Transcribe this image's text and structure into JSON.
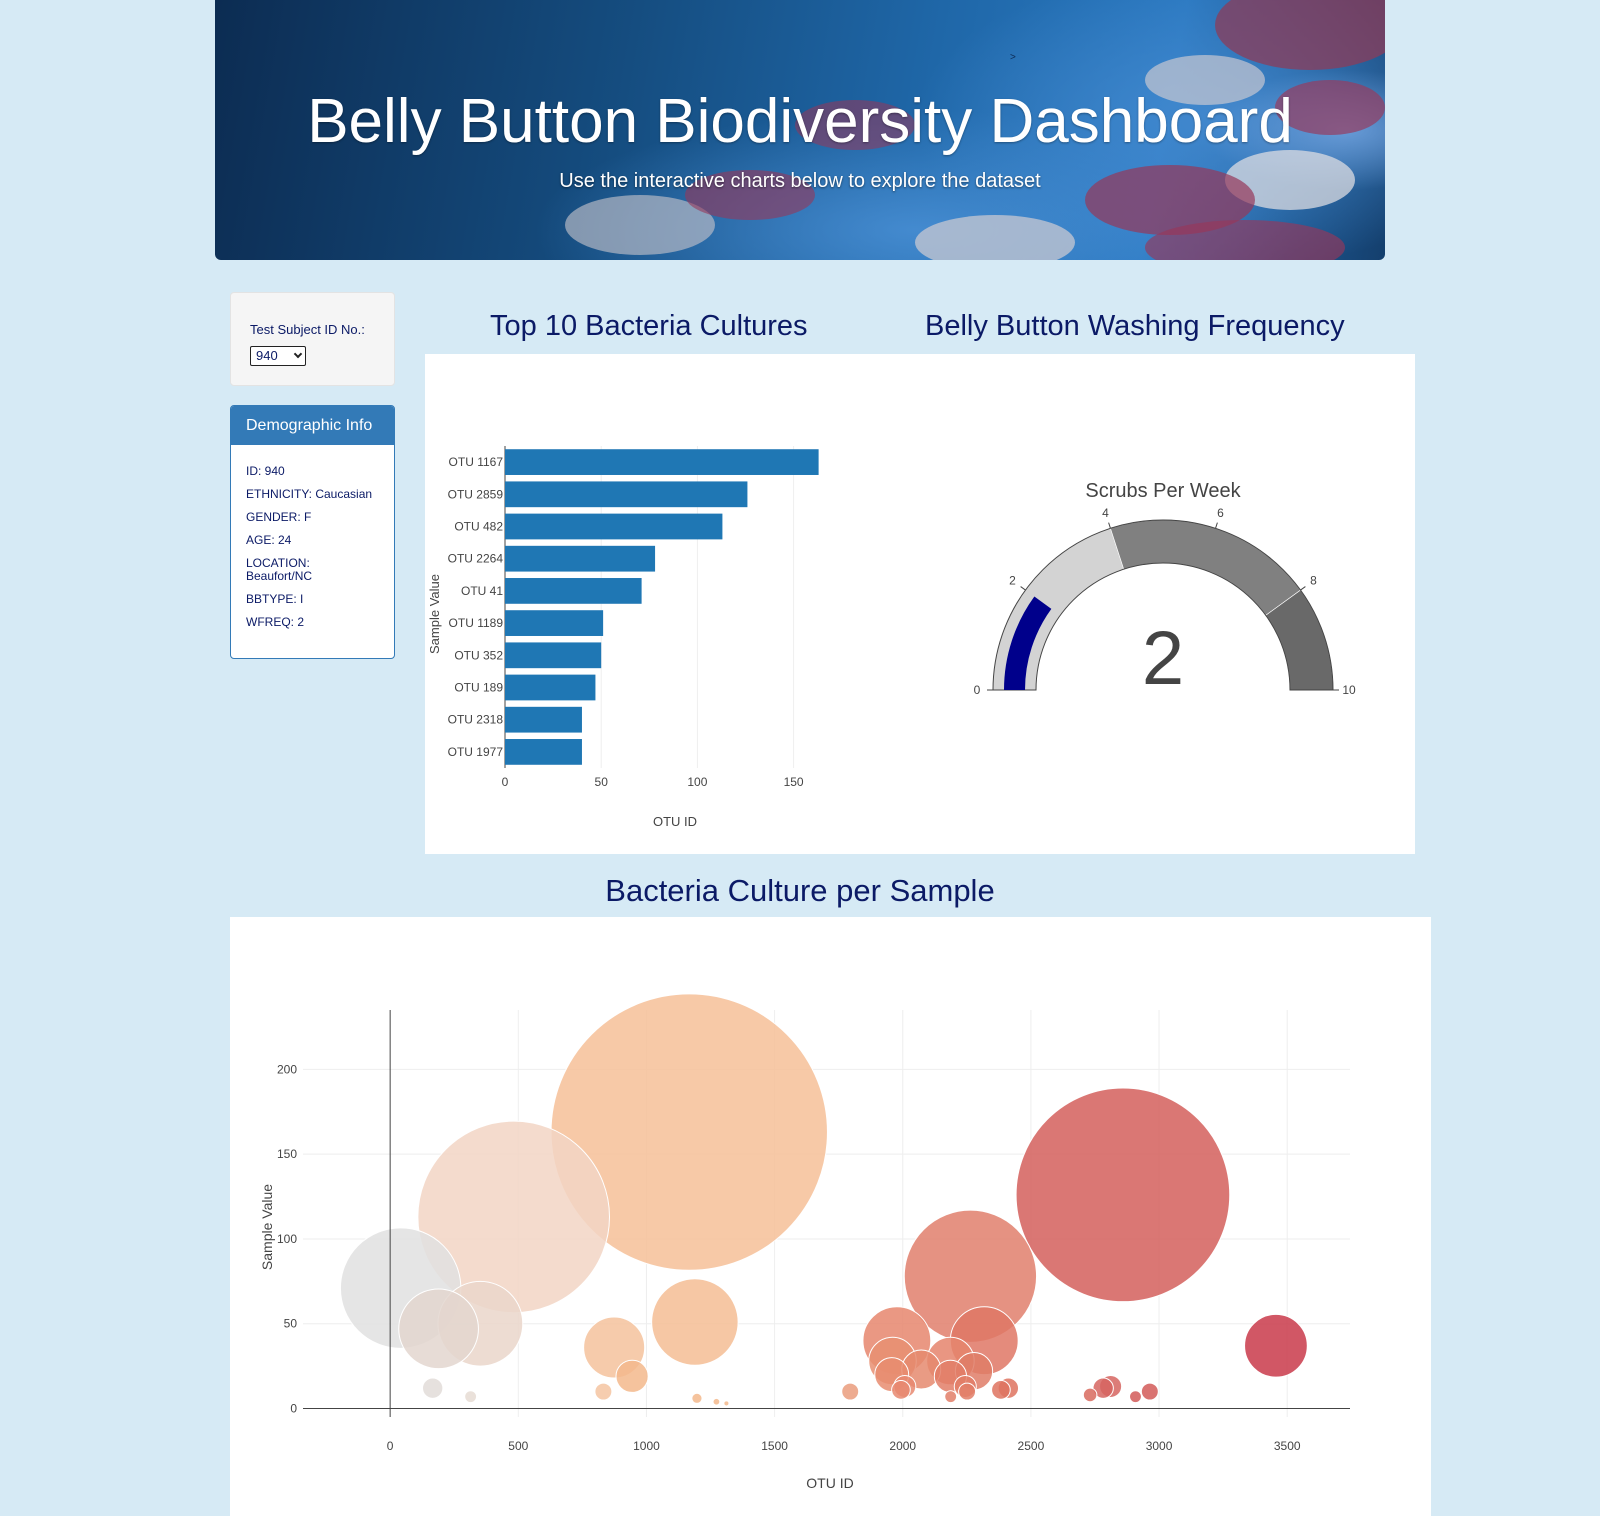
{
  "header": {
    "title": "Belly Button Biodiversity Dashboard",
    "subtitle": "Use the interactive charts below to explore the dataset",
    "mark": ">"
  },
  "selector": {
    "label": "Test Subject ID No.:",
    "selected": "940"
  },
  "demographics": {
    "heading": "Demographic Info",
    "lines": [
      "ID: 940",
      "ETHNICITY: Caucasian",
      "GENDER: F",
      "AGE: 24",
      "LOCATION: Beaufort/NC",
      "BBTYPE: I",
      "WFREQ: 2"
    ]
  },
  "headings": {
    "bar": "Top 10 Bacteria Cultures",
    "gauge": "Belly Button Washing Frequency",
    "bubble": "Bacteria Culture per Sample"
  },
  "colors": {
    "bar": "#1f77b4",
    "gauge_needle": "#00008b",
    "heading": "#0b1a66",
    "panel_heading": "#337ab7"
  },
  "chart_data": [
    {
      "type": "bar",
      "orientation": "horizontal",
      "categories": [
        "OTU 1167",
        "OTU 2859",
        "OTU 482",
        "OTU 2264",
        "OTU 41",
        "OTU 1189",
        "OTU 352",
        "OTU 189",
        "OTU 2318",
        "OTU 1977"
      ],
      "values": [
        163,
        126,
        113,
        78,
        71,
        51,
        50,
        47,
        40,
        40
      ],
      "xlabel": "OTU ID",
      "ylabel": "Sample Value",
      "xticks": [
        0,
        50,
        100,
        150
      ],
      "xlim": [
        0,
        171
      ],
      "color": "#1f77b4"
    },
    {
      "type": "gauge",
      "title": "Scrubs Per Week",
      "value": 2,
      "value_label": "2",
      "range": [
        0,
        10
      ],
      "ticks": [
        0,
        2,
        4,
        6,
        8,
        10
      ],
      "steps": [
        {
          "range": [
            0,
            4
          ],
          "color": "#d3d3d3"
        },
        {
          "range": [
            4,
            8
          ],
          "color": "#808080"
        },
        {
          "range": [
            8,
            10
          ],
          "color": "#696969"
        }
      ],
      "bar_color": "#00008b"
    },
    {
      "type": "scatter",
      "mode": "bubble",
      "xlabel": "OTU ID",
      "ylabel": "Sample Value",
      "xticks": [
        0,
        500,
        1000,
        1500,
        2000,
        2500,
        3000,
        3500
      ],
      "yticks": [
        0,
        50,
        100,
        150,
        200
      ],
      "xlim": [
        -340,
        3745
      ],
      "ylim": [
        -5,
        235
      ],
      "points": [
        {
          "x": 41,
          "y": 71,
          "color": "#e0e0e0"
        },
        {
          "x": 189,
          "y": 47,
          "color": "#e3d6cf"
        },
        {
          "x": 352,
          "y": 50,
          "color": "#ead6ca"
        },
        {
          "x": 482,
          "y": 113,
          "color": "#f2d5c4"
        },
        {
          "x": 1167,
          "y": 163,
          "color": "#f6bf98"
        },
        {
          "x": 1189,
          "y": 51,
          "color": "#f5bd94"
        },
        {
          "x": 874,
          "y": 36,
          "color": "#f5c29c"
        },
        {
          "x": 944,
          "y": 19,
          "color": "#f3b88c"
        },
        {
          "x": 2264,
          "y": 78,
          "color": "#e07f6c"
        },
        {
          "x": 2859,
          "y": 126,
          "color": "#d45f5c"
        },
        {
          "x": 1977,
          "y": 40,
          "color": "#e6866d"
        },
        {
          "x": 1960,
          "y": 28,
          "color": "#e88f72"
        },
        {
          "x": 1957,
          "y": 20,
          "color": "#e88c70"
        },
        {
          "x": 2072,
          "y": 23,
          "color": "#e58a6f"
        },
        {
          "x": 2186,
          "y": 28,
          "color": "#e5846c"
        },
        {
          "x": 2318,
          "y": 40,
          "color": "#df7765"
        },
        {
          "x": 2278,
          "y": 22,
          "color": "#df7c67"
        },
        {
          "x": 2186,
          "y": 19,
          "color": "#e27e67"
        },
        {
          "x": 3456,
          "y": 37,
          "color": "#c9394a"
        },
        {
          "x": 166,
          "y": 12,
          "color": "#e2dcd8"
        },
        {
          "x": 314,
          "y": 7,
          "color": "#e6dcd4"
        },
        {
          "x": 832,
          "y": 10,
          "color": "#f4c4a1"
        },
        {
          "x": 1795,
          "y": 10,
          "color": "#ea9c7c"
        },
        {
          "x": 2008,
          "y": 13,
          "color": "#e88870"
        },
        {
          "x": 1993,
          "y": 11,
          "color": "#e88870"
        },
        {
          "x": 2244,
          "y": 13,
          "color": "#e27e67"
        },
        {
          "x": 2251,
          "y": 10,
          "color": "#e27e67"
        },
        {
          "x": 2412,
          "y": 12,
          "color": "#de735f"
        },
        {
          "x": 2383,
          "y": 11,
          "color": "#de735f"
        },
        {
          "x": 2731,
          "y": 8,
          "color": "#d86a5e"
        },
        {
          "x": 2782,
          "y": 12,
          "color": "#d66560"
        },
        {
          "x": 2811,
          "y": 13,
          "color": "#d66560"
        },
        {
          "x": 2908,
          "y": 7,
          "color": "#d25a58"
        },
        {
          "x": 2964,
          "y": 10,
          "color": "#d25a58"
        },
        {
          "x": 2187,
          "y": 7,
          "color": "#e27e67"
        },
        {
          "x": 1197,
          "y": 6,
          "color": "#f3b88c"
        },
        {
          "x": 1273,
          "y": 4,
          "color": "#f3b88c"
        },
        {
          "x": 1312,
          "y": 3,
          "color": "#f3b88c"
        }
      ]
    }
  ]
}
